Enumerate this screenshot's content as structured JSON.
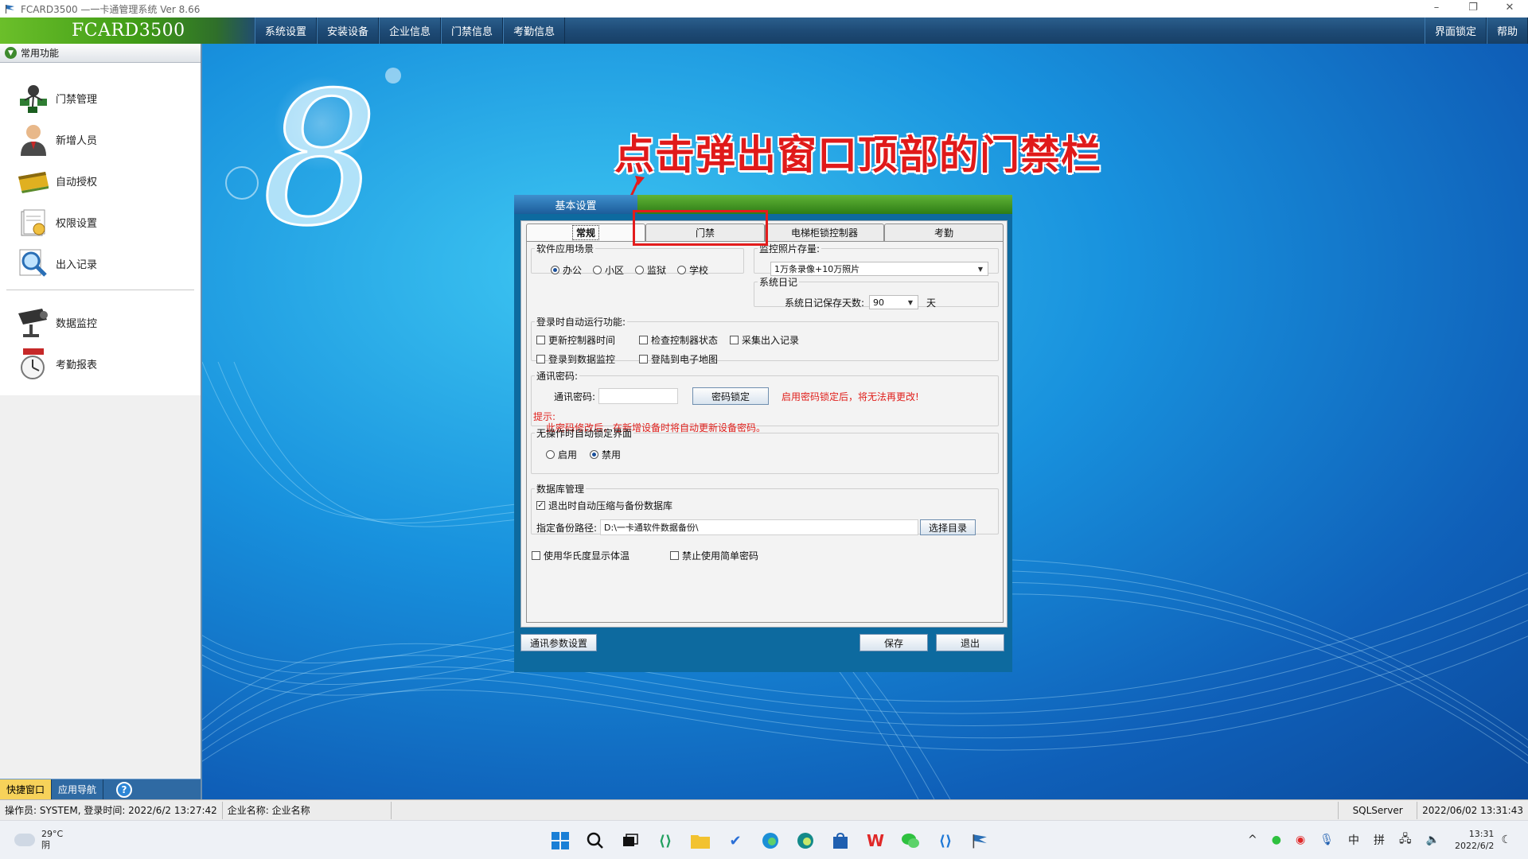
{
  "window": {
    "title": "FCARD3500 —一卡通管理系统  Ver 8.66",
    "controls": [
      "–",
      "❐",
      "✕"
    ]
  },
  "menubar": {
    "brand": "FCARD3500",
    "items": [
      "系统设置",
      "安装设备",
      "企业信息",
      "门禁信息",
      "考勤信息"
    ],
    "right_items": [
      "界面锁定",
      "帮助"
    ]
  },
  "sidebar": {
    "header": "常用功能",
    "group1": [
      {
        "label": "门禁管理",
        "icon": "door-access-icon"
      },
      {
        "label": "新增人员",
        "icon": "person-icon"
      },
      {
        "label": "自动授权",
        "icon": "card-icon"
      },
      {
        "label": "权限设置",
        "icon": "permission-icon"
      },
      {
        "label": "出入记录",
        "icon": "magnifier-icon"
      }
    ],
    "group2": [
      {
        "label": "数据监控",
        "icon": "camera-icon"
      },
      {
        "label": "考勤报表",
        "icon": "clock-icon"
      }
    ],
    "bottom_tabs": [
      "快捷窗口",
      "应用导航"
    ],
    "help_glyph": "?"
  },
  "main": {
    "logo_glyph": "8",
    "annotation": "点击弹出窗口顶部的门禁栏"
  },
  "dialog": {
    "title": "基本设置",
    "tabs": [
      "常规",
      "门禁",
      "电梯柜锁控制器",
      "考勤"
    ],
    "scene": {
      "legend": "软件应用场景",
      "options": [
        "办公",
        "小区",
        "监狱",
        "学校"
      ],
      "selected": 0
    },
    "photo": {
      "legend": "监控照片存量:",
      "value": "1万条录像+10万照片"
    },
    "syslog": {
      "legend": "系统日记",
      "label": "系统日记保存天数:",
      "value": "90",
      "unit": "天"
    },
    "autorun": {
      "legend": "登录时自动运行功能:",
      "items": [
        {
          "label": "更新控制器时间",
          "checked": false
        },
        {
          "label": "检查控制器状态",
          "checked": false
        },
        {
          "label": "采集出入记录",
          "checked": false
        },
        {
          "label": "登录到数据监控",
          "checked": false
        },
        {
          "label": "登陆到电子地图",
          "checked": false
        }
      ]
    },
    "password": {
      "legend": "通讯密码:",
      "label": "通讯密码:",
      "value": "",
      "lock_button": "密码锁定",
      "warning": "启用密码锁定后，将无法再更改!",
      "hint_label": "提示:",
      "hint": "此密码修改后，在新增设备时将自动更新设备密码。"
    },
    "idle_lock": {
      "legend": "无操作时自动锁定界面",
      "options": [
        "启用",
        "禁用"
      ],
      "selected": 1
    },
    "database": {
      "legend": "数据库管理",
      "auto_backup_label": "退出时自动压缩与备份数据库",
      "auto_backup_checked": true,
      "path_label": "指定备份路径:",
      "path_value": "D:\\一卡通软件数据备份\\",
      "browse_button": "选择目录"
    },
    "fahrenheit": {
      "label": "使用华氏度显示体温",
      "checked": false
    },
    "no_simple_pwd": {
      "label": "禁止使用简单密码",
      "checked": false
    },
    "footer": {
      "comm_button": "通讯参数设置",
      "save_button": "保存",
      "exit_button": "退出"
    }
  },
  "statusbar": {
    "operator": "操作员: SYSTEM, 登录时间: 2022/6/2 13:27:42",
    "company": "企业名称: 企业名称",
    "db": "SQLServer",
    "datetime": "2022/06/02 13:31:43"
  },
  "taskbar": {
    "weather_temp": "29°C",
    "weather_desc": "阴",
    "tray_chevron": "^",
    "ime_lang": "中",
    "ime_mode": "拼",
    "time": "13:31",
    "date": "2022/6/2"
  },
  "colors": {
    "annotation_red": "#e01a1a",
    "menubar_blue": "#1e4b76",
    "brand_green": "#3f9b16",
    "dialog_frame": "#0d6a9f"
  }
}
